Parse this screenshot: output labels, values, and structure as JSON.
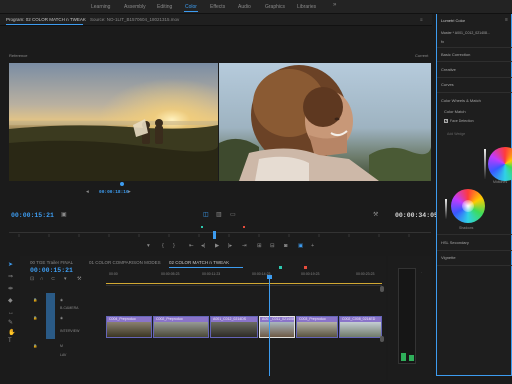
{
  "workspaces": {
    "tabs": [
      "Learning",
      "Assembly",
      "Editing",
      "Color",
      "Effects",
      "Audio",
      "Graphics",
      "Libraries"
    ],
    "active": "Color",
    "more": "»"
  },
  "monitor": {
    "program_tab": "Program: 02 COLOR MATCH n TWEAK",
    "source_tab": "Source: NO-1LIT_B1570604_18021315.mov",
    "menu_glyph": "≡",
    "ref_label": "Reference",
    "cur_label": "Current",
    "ref_timecode": "00:00:18:10",
    "current_timecode": "00:00:15:21",
    "duration_timecode": "00:00:34:05"
  },
  "lumetri": {
    "title": "Lumetri Color",
    "master": "Master * A001_C012_021408...",
    "fx": "fx",
    "sections": [
      "Basic Correction",
      "Creative",
      "Curves",
      "Color Wheels & Match",
      "HSL Secondary",
      "Vignette"
    ],
    "color_match": "Color Match",
    "face_detection": "Face Detection",
    "face_detection_checked": true,
    "add_wedge": "Add Wedge",
    "midtones": "Midtones",
    "shadows": "Shadows"
  },
  "timeline": {
    "tabs": [
      "00 TGE Trailer FINAL",
      "01 COLOR COMPARISON MODES",
      "02 COLOR MATCH n TWEAK"
    ],
    "active": "02 COLOR MATCH n TWEAK",
    "timecode": "00:00:15:21",
    "ruler": [
      "00:00",
      "00:00:05:23",
      "00:00:11:23",
      "00:00:14:23",
      "00:00:19:23",
      "00:00:23:23"
    ],
    "tracks": [
      "V3",
      "V2",
      "V1",
      "A1"
    ],
    "track_names": [
      "B-CAMERA",
      "INTERVIEW",
      "LAV"
    ],
    "clips": [
      {
        "label": "C004_Preproduo",
        "tone": "dusk"
      },
      {
        "label": "C002_Preproduo",
        "tone": "dusk"
      },
      {
        "label": "A001_C012_0214DS",
        "tone": "face"
      },
      {
        "label": "A001_C011_021408",
        "tone": "face"
      },
      {
        "label": "C003_Preproduo",
        "tone": "dusk"
      },
      {
        "label": "C002_C008_0214ED",
        "tone": "sky"
      }
    ]
  },
  "colors": {
    "accent": "#3d9cf0",
    "clip": "#4a4a8f",
    "clip_header": "#8a74c9",
    "playhead": "#3d9cf0"
  }
}
